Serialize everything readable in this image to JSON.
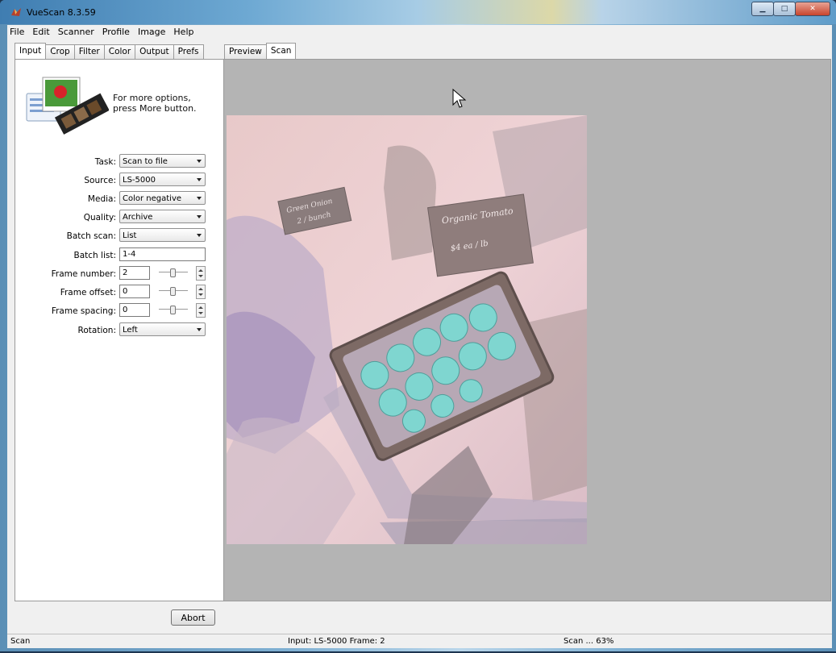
{
  "window": {
    "title": "VueScan 8.3.59"
  },
  "menu": [
    "File",
    "Edit",
    "Scanner",
    "Profile",
    "Image",
    "Help"
  ],
  "left_tabs": [
    "Input",
    "Crop",
    "Filter",
    "Color",
    "Output",
    "Prefs"
  ],
  "left_active_tab": "Input",
  "hint": {
    "line1": "For more options,",
    "line2": "press More button."
  },
  "options": {
    "task": {
      "label": "Task:",
      "value": "Scan to file"
    },
    "source": {
      "label": "Source:",
      "value": "LS-5000"
    },
    "media": {
      "label": "Media:",
      "value": "Color negative"
    },
    "quality": {
      "label": "Quality:",
      "value": "Archive"
    },
    "batch": {
      "label": "Batch scan:",
      "value": "List"
    },
    "batch_list": {
      "label": "Batch list:",
      "value": "1-4"
    },
    "frame_number": {
      "label": "Frame number:",
      "value": "2"
    },
    "frame_offset": {
      "label": "Frame offset:",
      "value": "0"
    },
    "frame_spacing": {
      "label": "Frame spacing:",
      "value": "0"
    },
    "rotation": {
      "label": "Rotation:",
      "value": "Left"
    }
  },
  "abort_label": "Abort",
  "right_tabs": [
    "Preview",
    "Scan"
  ],
  "right_active_tab": "Scan",
  "scan_image": {
    "description_labels": [
      "Organic Tomato",
      "Green Onion"
    ],
    "price_tags": [
      "$4 ea / lb",
      "2 / bunch"
    ]
  },
  "status": {
    "left": "Scan",
    "mid": "Input: LS-5000 Frame: 2",
    "right": "Scan ... 63%"
  },
  "colors": {
    "view_bg": "#b4b4b4",
    "panel_bg": "#ffffff",
    "chrome": "#f0f0f0"
  }
}
